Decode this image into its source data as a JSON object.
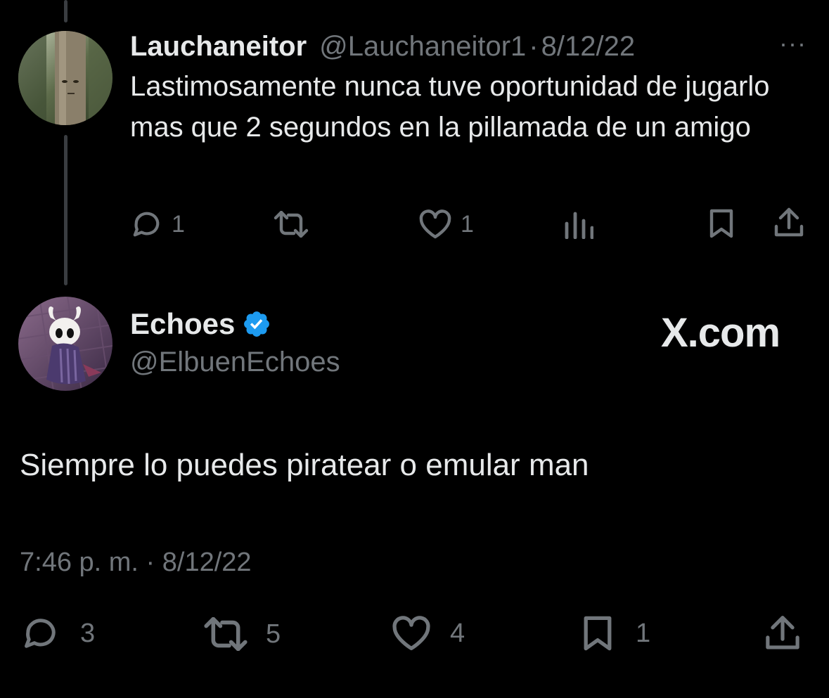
{
  "reply": {
    "display_name": "Lauchaneitor",
    "handle": "@Lauchaneitor1",
    "separator": "·",
    "date": "8/12/22",
    "text": "Lastimosamente nunca tuve oportunidad de jugarlo mas que 2 segundos en la pillamada de un amigo",
    "more_icon": "more-icon",
    "actions": {
      "reply_count": "1",
      "repost_count": "",
      "like_count": "1",
      "views_icon": "views-icon",
      "bookmark_icon": "bookmark-icon",
      "share_icon": "share-icon"
    }
  },
  "main_tweet": {
    "display_name": "Echoes",
    "handle": "@ElbuenEchoes",
    "verified_icon": "verified-badge-icon",
    "watermark": "X.com",
    "text": "Siempre lo puedes piratear o emular man",
    "time": "7:46 p. m.",
    "separator": "·",
    "date": "8/12/22",
    "actions": {
      "reply_count": "3",
      "repost_count": "5",
      "like_count": "4",
      "bookmark_count": "1",
      "share_icon": "share-icon"
    }
  },
  "colors": {
    "background": "#000000",
    "text_primary": "#e7e9ea",
    "text_secondary": "#71767b",
    "verified_blue": "#1d9bf0",
    "thread_line": "#3a3d41"
  }
}
